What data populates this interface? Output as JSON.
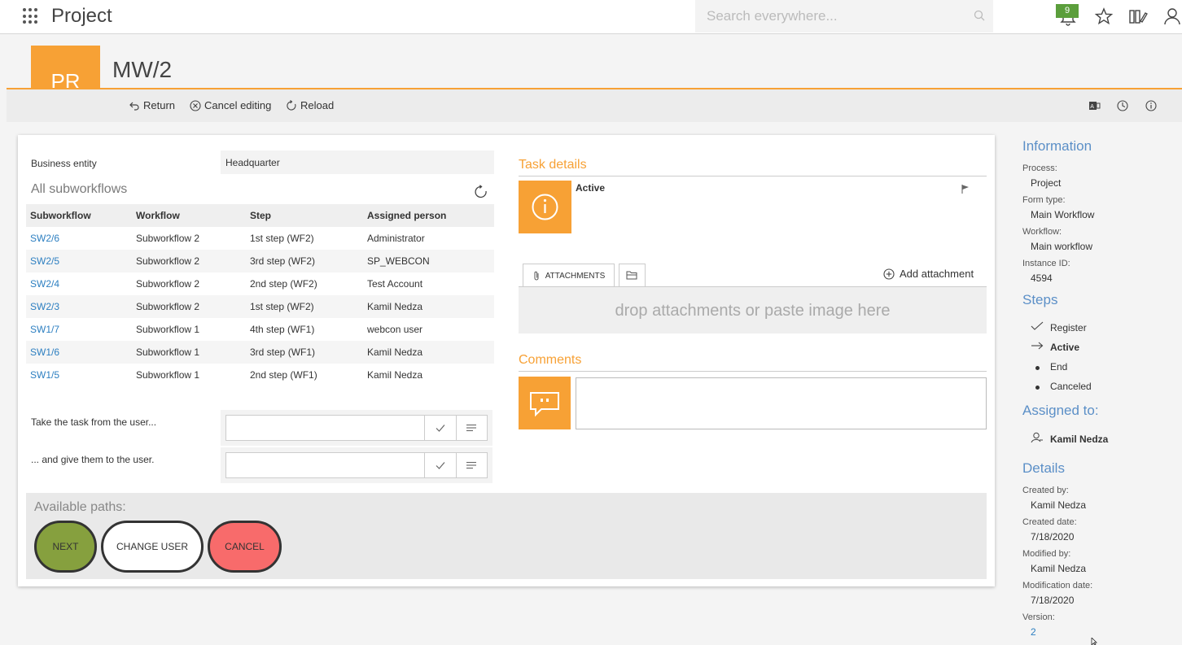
{
  "topbar": {
    "app_title": "Project",
    "search_placeholder": "Search everywhere...",
    "notification_count": "9"
  },
  "header": {
    "tile_initials": "PR",
    "doc_title": "MW/2",
    "toolbar": {
      "return_label": "Return",
      "cancel_label": "Cancel editing",
      "reload_label": "Reload"
    }
  },
  "form": {
    "business_entity_label": "Business entity",
    "business_entity_value": "Headquarter",
    "subworkflows_title": "All subworkflows",
    "columns": [
      "Subworkflow",
      "Workflow",
      "Step",
      "Assigned person"
    ],
    "rows": [
      {
        "id": "SW2/6",
        "workflow": "Subworkflow 2",
        "step": "1st step (WF2)",
        "person": "Administrator"
      },
      {
        "id": "SW2/5",
        "workflow": "Subworkflow 2",
        "step": "3rd step (WF2)",
        "person": "SP_WEBCON"
      },
      {
        "id": "SW2/4",
        "workflow": "Subworkflow 2",
        "step": "2nd step (WF2)",
        "person": "Test Account"
      },
      {
        "id": "SW2/3",
        "workflow": "Subworkflow 2",
        "step": "1st step (WF2)",
        "person": "Kamil Nedza"
      },
      {
        "id": "SW1/7",
        "workflow": "Subworkflow 1",
        "step": "4th step (WF1)",
        "person": "webcon user"
      },
      {
        "id": "SW1/6",
        "workflow": "Subworkflow 1",
        "step": "3rd step (WF1)",
        "person": "Kamil Nedza"
      },
      {
        "id": "SW1/5",
        "workflow": "Subworkflow 1",
        "step": "2nd step (WF1)",
        "person": "Kamil Nedza"
      }
    ],
    "take_task_label": "Take the task from the user...",
    "give_task_label": "... and give them to the user.",
    "paths_title": "Available paths:",
    "paths": {
      "next": "NEXT",
      "change_user": "CHANGE USER",
      "cancel": "CANCEL"
    },
    "colors": {
      "next": "#86a03e",
      "change_user": "#ffffff",
      "cancel": "#f86b6b",
      "accent": "#f7a135"
    }
  },
  "task": {
    "title": "Task details",
    "status": "Active",
    "attachments_tab": "ATTACHMENTS",
    "add_attachment": "Add attachment",
    "drop_text": "drop attachments or paste image here",
    "comments_title": "Comments"
  },
  "info": {
    "information_title": "Information",
    "process_label": "Process:",
    "process_value": "Project",
    "form_type_label": "Form type:",
    "form_type_value": "Main Workflow",
    "workflow_label": "Workflow:",
    "workflow_value": "Main workflow",
    "instance_label": "Instance ID:",
    "instance_value": "4594",
    "steps_title": "Steps",
    "steps": [
      "Register",
      "Active",
      "End",
      "Canceled"
    ],
    "assigned_title": "Assigned to:",
    "assigned_person": "Kamil Nedza",
    "details_title": "Details",
    "created_by_label": "Created by:",
    "created_by_value": "Kamil Nedza",
    "created_date_label": "Created date:",
    "created_date_value": "7/18/2020",
    "modified_by_label": "Modified by:",
    "modified_by_value": "Kamil Nedza",
    "modification_date_label": "Modification date:",
    "modification_date_value": "7/18/2020",
    "version_label": "Version:",
    "version_value": "2"
  }
}
